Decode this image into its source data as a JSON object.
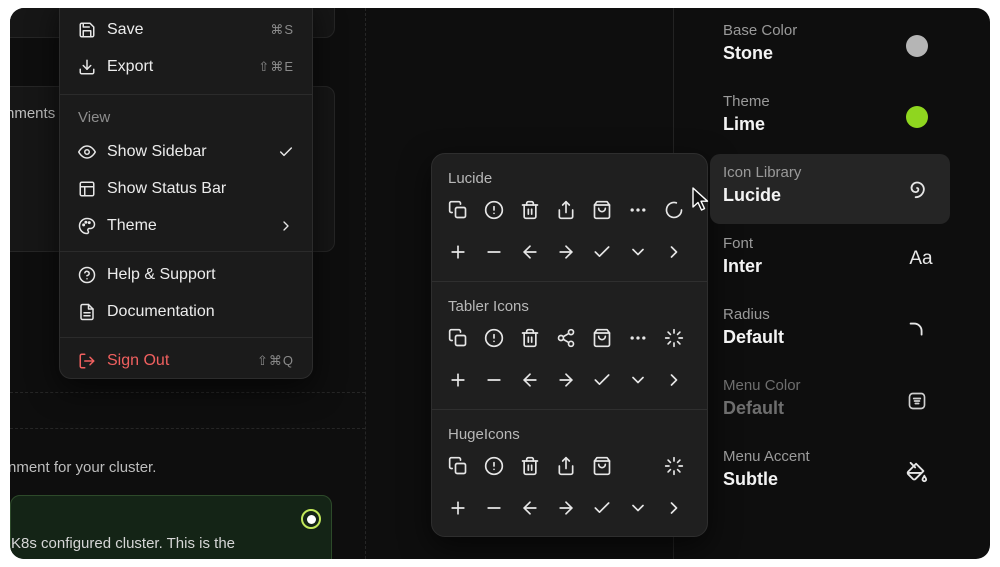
{
  "background": {
    "card_text_partial": "nments",
    "description_partial": "nment for your cluster.",
    "green_card_text_partial": "K8s configured cluster. This is the"
  },
  "menu": {
    "items_top": [
      {
        "label": "Save",
        "icon": "save-icon",
        "shortcut": "⌘S"
      },
      {
        "label": "Export",
        "icon": "download-icon",
        "shortcut": "⇧⌘E"
      }
    ],
    "view_section_label": "View",
    "view_items": [
      {
        "label": "Show Sidebar",
        "icon": "eye-icon",
        "checked": true
      },
      {
        "label": "Show Status Bar",
        "icon": "layout-icon"
      },
      {
        "label": "Theme",
        "icon": "palette-icon",
        "submenu": true
      }
    ],
    "help_items": [
      {
        "label": "Help & Support",
        "icon": "help-circle-icon"
      },
      {
        "label": "Documentation",
        "icon": "file-text-icon"
      }
    ],
    "sign_out": {
      "label": "Sign Out",
      "icon": "log-out-icon",
      "shortcut": "⇧⌘Q",
      "color": "#f0605f"
    }
  },
  "icon_libraries": [
    {
      "name": "Lucide",
      "row1": [
        "copy-icon",
        "alert-circle-icon",
        "trash-icon",
        "share-icon",
        "shopping-bag-icon",
        "more-horizontal-icon",
        "loader-circle-icon"
      ],
      "row2": [
        "plus-icon",
        "minus-icon",
        "arrow-left-icon",
        "arrow-right-icon",
        "check-icon",
        "chevron-down-icon",
        "chevron-right-icon"
      ]
    },
    {
      "name": "Tabler Icons",
      "row1": [
        "copy-icon",
        "alert-circle-icon",
        "trash-icon",
        "share-nodes-icon",
        "shopping-bag-icon",
        "more-horizontal-icon",
        "loader-spokes-icon"
      ],
      "row2": [
        "plus-icon",
        "minus-icon",
        "arrow-left-icon",
        "arrow-right-icon",
        "check-icon",
        "chevron-down-icon",
        "chevron-right-icon"
      ]
    },
    {
      "name": "HugeIcons",
      "row1": [
        "copy-icon",
        "alert-circle-icon",
        "trash-icon",
        "share-icon",
        "shopping-bag-icon",
        "blank",
        "loader-spokes-icon"
      ],
      "row2": [
        "plus-icon",
        "minus-icon",
        "arrow-left-icon",
        "arrow-right-icon",
        "check-icon",
        "chevron-down-icon",
        "chevron-right-icon"
      ]
    }
  ],
  "settings": [
    {
      "label": "Base Color",
      "value": "Stone",
      "icon": "color-swatch",
      "color": "#b5b5b5"
    },
    {
      "label": "Theme",
      "value": "Lime",
      "icon": "color-swatch",
      "color": "#8fd61f"
    },
    {
      "label": "Icon Library",
      "value": "Lucide",
      "icon": "spiral-icon",
      "active": true
    },
    {
      "label": "Font",
      "value": "Inter",
      "icon": "font-aa-icon",
      "glyph": "Aa"
    },
    {
      "label": "Radius",
      "value": "Default",
      "icon": "radius-corner-icon"
    },
    {
      "label": "Menu Color",
      "value": "Default",
      "icon": "menu-square-icon",
      "muted": true
    },
    {
      "label": "Menu Accent",
      "value": "Subtle",
      "icon": "paint-bucket-icon"
    }
  ],
  "colors": {
    "background": "#0e0e0e",
    "menu_bg": "#1b1b1b",
    "popover_bg": "#1f1f1f",
    "accent_lime": "#8fd61f",
    "danger": "#f0605f"
  }
}
